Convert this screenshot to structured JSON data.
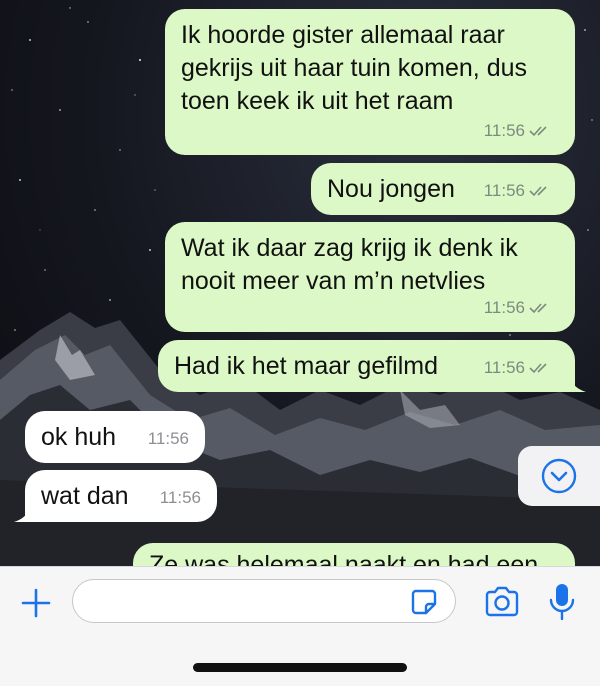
{
  "colors": {
    "outgoing_bubble": "#dcf8c6",
    "incoming_bubble": "#ffffff",
    "accent": "#1a73e8",
    "read_ticks": "#7d8b7e"
  },
  "messages": [
    {
      "direction": "out",
      "text": "Ik hoorde gister allemaal raar\ngekrijs uit haar tuin komen, dus\ntoen keek ik uit het raam",
      "time": "11:56",
      "status": "double-check-icon"
    },
    {
      "direction": "out",
      "text": "Nou jongen",
      "time": "11:56",
      "status": "double-check-icon"
    },
    {
      "direction": "out",
      "text": "Wat ik daar zag krijg ik denk ik\nnooit meer van m’n netvlies",
      "time": "11:56",
      "status": "double-check-icon"
    },
    {
      "direction": "out",
      "text": "Had ik het maar gefilmd",
      "time": "11:56",
      "status": "double-check-icon"
    },
    {
      "direction": "in",
      "text": "ok huh",
      "time": "11:56"
    },
    {
      "direction": "in",
      "text": "wat dan",
      "time": "11:56"
    },
    {
      "direction": "out",
      "text": "Ze was helemaal naakt en had een",
      "time": "",
      "partially_visible": true
    }
  ],
  "scroll_button": {
    "icon": "chevron-down-circle-icon"
  },
  "compose": {
    "placeholder": "",
    "value": "",
    "icons": [
      "plus-icon",
      "sticker-icon",
      "camera-icon",
      "microphone-icon"
    ]
  }
}
